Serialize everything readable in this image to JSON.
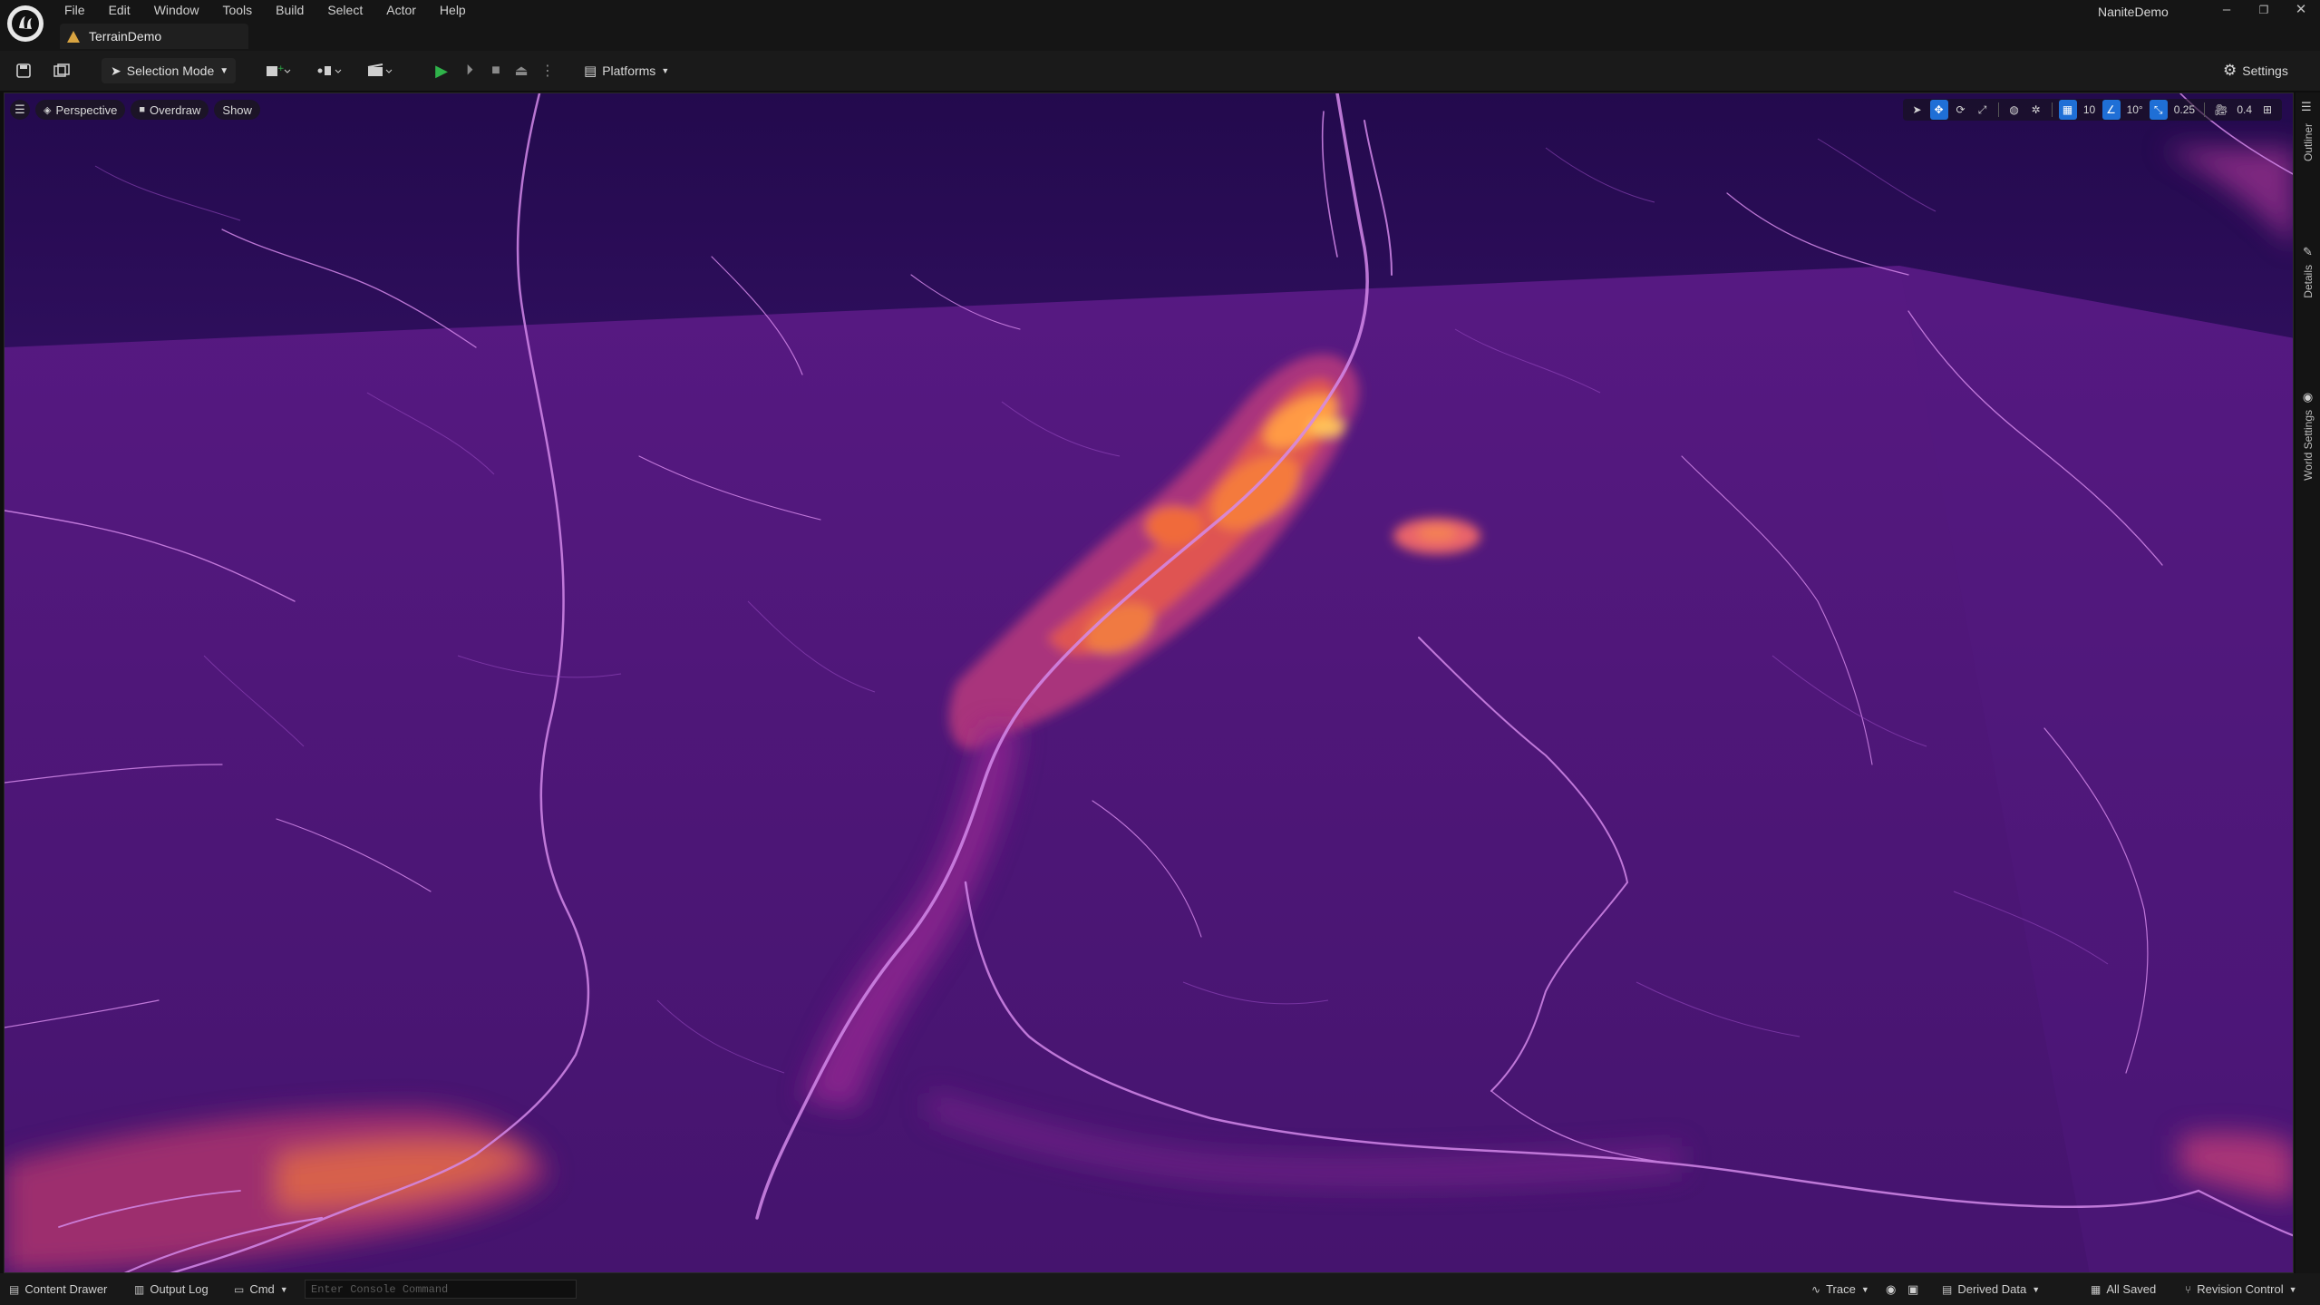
{
  "window": {
    "project_name": "NaniteDemo",
    "level_tab": "TerrainDemo",
    "controls": [
      "–",
      "❐",
      "✕"
    ]
  },
  "menu": [
    "File",
    "Edit",
    "Window",
    "Tools",
    "Build",
    "Select",
    "Actor",
    "Help"
  ],
  "toolbar": {
    "selection_mode_label": "Selection Mode",
    "platforms_label": "Platforms",
    "settings_label": "Settings",
    "icons": [
      "save-icon",
      "content-browser-icon",
      "add-actor-icon",
      "blueprint-icon",
      "cinematics-icon",
      "play-icon",
      "advance-frame-icon",
      "stop-icon",
      "eject-icon",
      "more-options-icon"
    ]
  },
  "viewport": {
    "view_mode_label": "Perspective",
    "visualization_label": "Overdraw",
    "show_label": "Show",
    "grid_snap_value": "10",
    "rotation_snap_value": "10°",
    "scale_snap_value": "0.25",
    "camera_speed_value": "0.4",
    "colors": {
      "background": "#4a1470",
      "dark_band": "#2c0c5a",
      "crack": "#c06ad8",
      "hot": "#ff8a3c",
      "hottest": "#ffb24a"
    }
  },
  "side_tabs": [
    "Outliner",
    "Details",
    "World Settings"
  ],
  "statusbar": {
    "content_drawer": "Content Drawer",
    "output_log": "Output Log",
    "cmd": "Cmd",
    "console_placeholder": "Enter Console Command",
    "trace": "Trace",
    "derived_data": "Derived Data",
    "all_saved": "All Saved",
    "revision_control": "Revision Control"
  }
}
